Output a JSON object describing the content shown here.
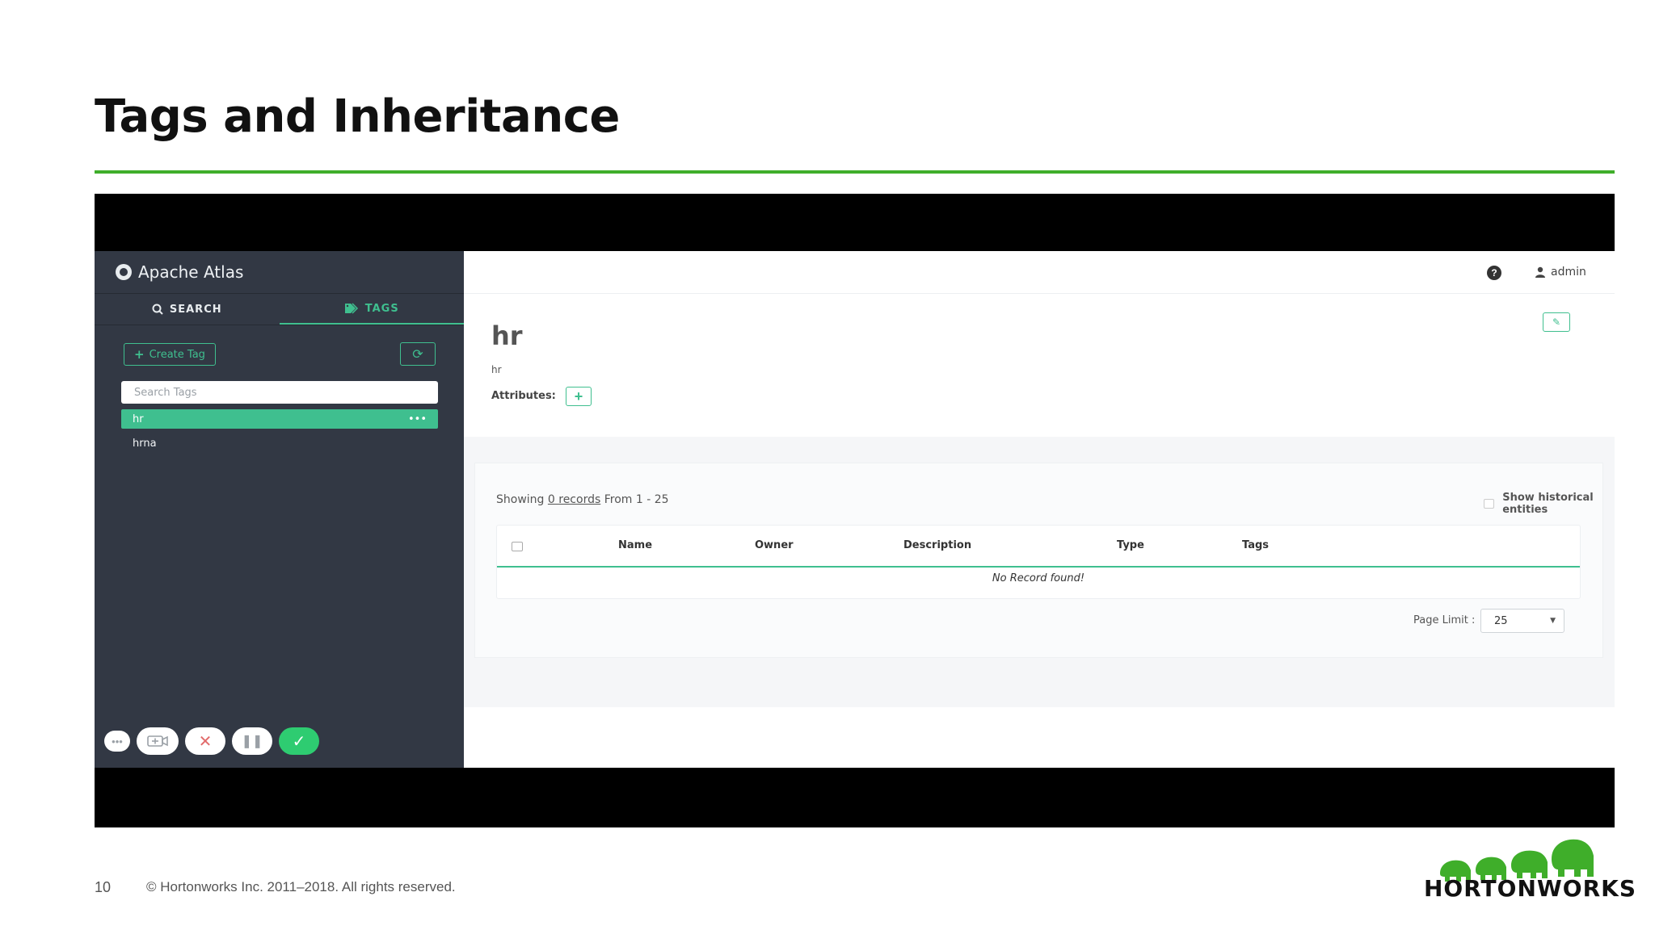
{
  "slide": {
    "title": "Tags and Inheritance",
    "page_number": "10",
    "copyright": "© Hortonworks Inc. 2011–2018. All rights reserved.",
    "logo_text": "HORTONWORKS",
    "accent_color": "#3fae2a"
  },
  "app": {
    "brand": "Apache Atlas",
    "accent_color": "#3fbf8f",
    "sidebar_color": "#323844",
    "tabs": [
      {
        "label": "SEARCH",
        "icon": "search-icon",
        "active": false
      },
      {
        "label": "TAGS",
        "icon": "tag-icon",
        "active": true
      }
    ],
    "create_tag_label": "Create Tag",
    "search_placeholder": "Search Tags",
    "tags": [
      {
        "label": "hr",
        "selected": true,
        "menu": "•••"
      },
      {
        "label": "hrna",
        "selected": false
      }
    ],
    "user": "admin",
    "entity": {
      "title": "hr",
      "subtitle": "hr",
      "attributes_label": "Attributes:"
    },
    "results": {
      "showing_prefix": "Showing",
      "showing_link": "0 records",
      "showing_suffix": "From 1 - 25",
      "historical_label": "Show historical entities",
      "columns": [
        "Name",
        "Owner",
        "Description",
        "Type",
        "Tags"
      ],
      "empty_message": "No Record found!",
      "page_limit_label": "Page Limit :",
      "page_limit_value": "25"
    }
  }
}
